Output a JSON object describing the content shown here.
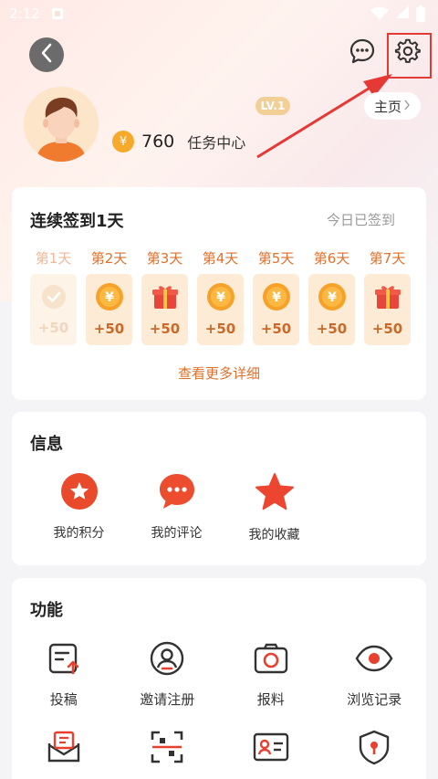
{
  "status_bar": {
    "time": "2:12"
  },
  "profile": {
    "level": "LV.1",
    "home_label": "主页",
    "coins": "760",
    "task_center": "任务中心"
  },
  "checkin": {
    "title": "连续签到1天",
    "status": "今日已签到",
    "more": "查看更多详细",
    "days": [
      {
        "label": "第1天",
        "points": "+50",
        "icon": "check-icon",
        "done": true
      },
      {
        "label": "第2天",
        "points": "+50",
        "icon": "yuan-coin-icon",
        "done": false
      },
      {
        "label": "第3天",
        "points": "+50",
        "icon": "gift-icon",
        "done": false
      },
      {
        "label": "第4天",
        "points": "+50",
        "icon": "yuan-coin-icon",
        "done": false
      },
      {
        "label": "第5天",
        "points": "+50",
        "icon": "yuan-coin-icon",
        "done": false
      },
      {
        "label": "第6天",
        "points": "+50",
        "icon": "yuan-coin-icon",
        "done": false
      },
      {
        "label": "第7天",
        "points": "+50",
        "icon": "gift-icon",
        "done": false
      }
    ]
  },
  "info": {
    "title": "信息",
    "items": [
      {
        "label": "我的积分",
        "icon": "points-star-icon"
      },
      {
        "label": "我的评论",
        "icon": "comment-icon"
      },
      {
        "label": "我的收藏",
        "icon": "favorite-star-icon"
      }
    ]
  },
  "functions": {
    "title": "功能",
    "items": [
      {
        "label": "投稿",
        "icon": "submit-icon"
      },
      {
        "label": "邀请注册",
        "icon": "invite-icon"
      },
      {
        "label": "报料",
        "icon": "camera-icon"
      },
      {
        "label": "浏览记录",
        "icon": "eye-icon"
      },
      {
        "label": "",
        "icon": "feedback-mail-icon"
      },
      {
        "label": "",
        "icon": "scan-icon"
      },
      {
        "label": "",
        "icon": "id-card-icon"
      },
      {
        "label": "",
        "icon": "shield-icon"
      }
    ]
  },
  "colors": {
    "accent": "#e0702a",
    "red": "#e8402e",
    "highlight_box": "#e53935"
  }
}
